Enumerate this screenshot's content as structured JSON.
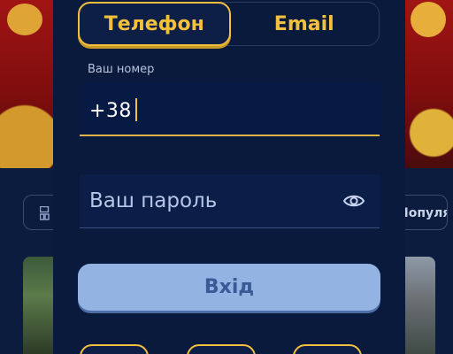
{
  "auth": {
    "tabs": [
      {
        "label": "Телефон",
        "active": true
      },
      {
        "label": "Email",
        "active": false
      }
    ],
    "phone": {
      "label": "Ваш номер",
      "value": "+38"
    },
    "password": {
      "placeholder": "Ваш пароль",
      "icon": "eye-icon"
    },
    "login_button": "Вхід"
  },
  "background": {
    "sort_label": "Популярні",
    "filter_icon": "grid-icon"
  },
  "colors": {
    "accent": "#f2bf3e",
    "modal_bg": "#0a1a3c",
    "button_bg": "#93b3e3",
    "button_text": "#3a5a95"
  }
}
